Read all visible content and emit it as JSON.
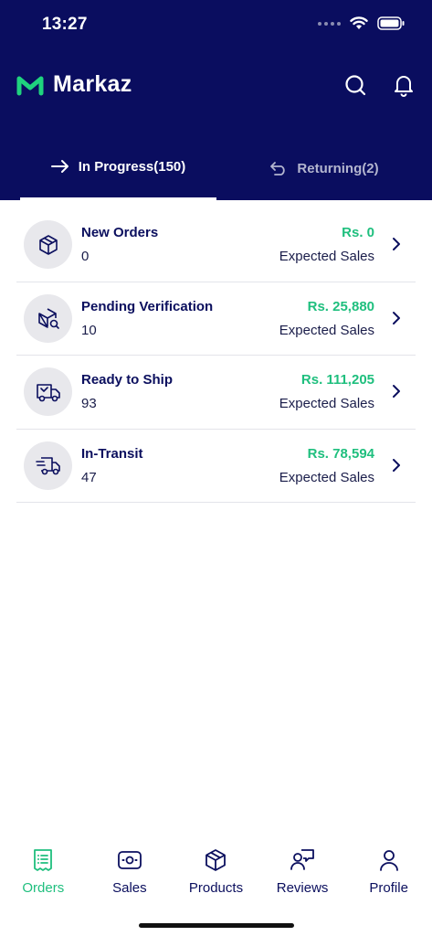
{
  "status_bar": {
    "time": "13:27"
  },
  "app": {
    "name": "Markaz"
  },
  "tabs": [
    {
      "label": "In Progress(150)",
      "active": true,
      "icon": "arrow-right-icon"
    },
    {
      "label": "Returning(2)",
      "active": false,
      "icon": "return-arrow-icon"
    }
  ],
  "orders": [
    {
      "title": "New Orders",
      "count": "0",
      "amount": "Rs. 0",
      "sub": "Expected Sales",
      "icon": "box-icon"
    },
    {
      "title": "Pending Verification",
      "count": "10",
      "amount": "Rs. 25,880",
      "sub": "Expected Sales",
      "icon": "box-search-icon"
    },
    {
      "title": "Ready to Ship",
      "count": "93",
      "amount": "Rs. 111,205",
      "sub": "Expected Sales",
      "icon": "truck-box-icon"
    },
    {
      "title": "In-Transit",
      "count": "47",
      "amount": "Rs. 78,594",
      "sub": "Expected Sales",
      "icon": "truck-fast-icon"
    }
  ],
  "bottom_nav": [
    {
      "label": "Orders",
      "active": true,
      "icon": "orders-icon"
    },
    {
      "label": "Sales",
      "active": false,
      "icon": "sales-icon"
    },
    {
      "label": "Products",
      "active": false,
      "icon": "products-icon"
    },
    {
      "label": "Reviews",
      "active": false,
      "icon": "reviews-icon"
    },
    {
      "label": "Profile",
      "active": false,
      "icon": "profile-icon"
    }
  ],
  "colors": {
    "header_bg": "#0a0d5f",
    "accent_green": "#1fbf7e",
    "text_navy": "#0b0f5e"
  }
}
